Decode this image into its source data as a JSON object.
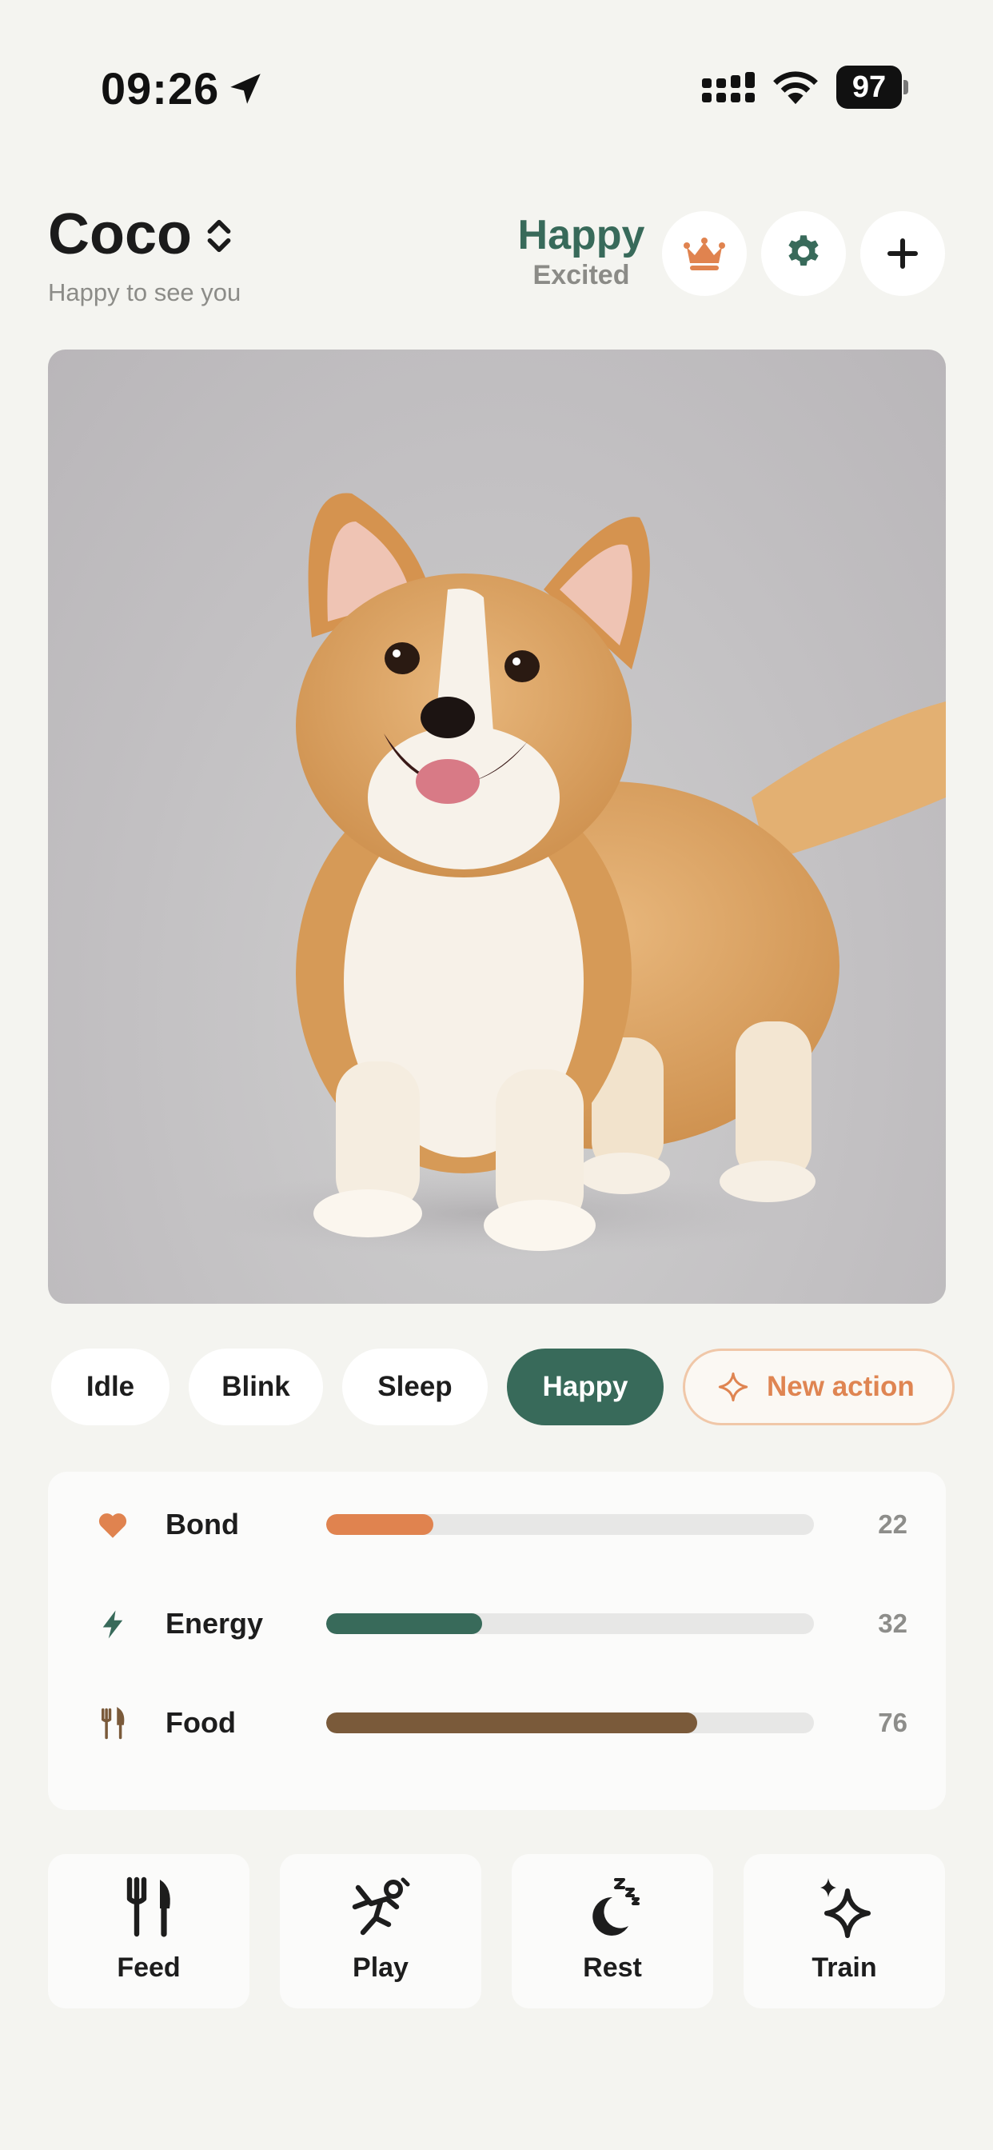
{
  "status_bar": {
    "time": "09:26",
    "battery": "97",
    "icons": [
      "location-arrow-icon",
      "cellular-signal-icon",
      "wifi-icon",
      "battery-icon"
    ]
  },
  "header": {
    "pet_name": "Coco",
    "subtitle": "Happy to see you",
    "mood_primary": "Happy",
    "mood_secondary": "Excited",
    "buttons": [
      "crown-icon",
      "gear-icon",
      "plus-icon"
    ]
  },
  "pet_image": {
    "subject": "corgi-dog-photo"
  },
  "chips": {
    "items": [
      "Idle",
      "Blink",
      "Sleep",
      "Happy"
    ],
    "selected": "Happy",
    "new_action": "New action"
  },
  "stats": [
    {
      "label": "Bond",
      "value": "22",
      "percent": 22,
      "color": "#e0834f",
      "icon": "heart-icon"
    },
    {
      "label": "Energy",
      "value": "32",
      "percent": 32,
      "color": "#386a5a",
      "icon": "lightning-icon"
    },
    {
      "label": "Food",
      "value": "76",
      "percent": 76,
      "color": "#7a5a3a",
      "icon": "utensils-icon"
    }
  ],
  "actions": [
    {
      "label": "Feed",
      "icon": "fork-knife-icon"
    },
    {
      "label": "Play",
      "icon": "play-figure-icon"
    },
    {
      "label": "Rest",
      "icon": "moon-zzz-icon"
    },
    {
      "label": "Train",
      "icon": "sparkles-icon"
    }
  ],
  "colors": {
    "background": "#f4f4f0",
    "accent_green": "#386a5a",
    "accent_orange": "#e0834f",
    "food_brown": "#7a5a3a"
  }
}
